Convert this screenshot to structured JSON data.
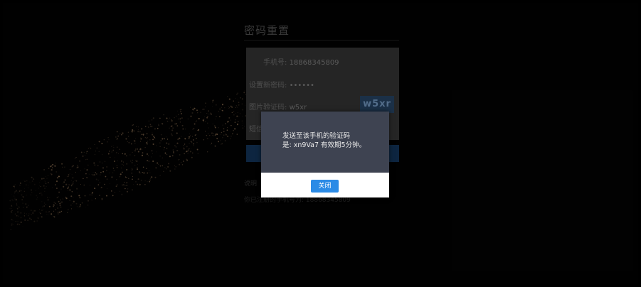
{
  "page": {
    "title": "密码重置",
    "colors": {
      "background": "#000000",
      "modal_body": "#3e4351",
      "primary_button": "#2b8be6"
    }
  },
  "form": {
    "phone_label": "手机号:",
    "phone_value": "18868345809",
    "new_password_label": "设置新密码:",
    "new_password_value": "••••••",
    "image_captcha_label": "图片验证码:",
    "image_captcha_value": "w5xr",
    "captcha_image_text": "w5xr",
    "sms_code_label": "短信"
  },
  "footer": {
    "tip": "说明",
    "registered_phone": "你已注册的手机号为: 18868345809"
  },
  "modal": {
    "message_line1": "发送至该手机的验证码",
    "message_line2": "是: xn9Va7 有效期5分钟。",
    "close_label": "关闭"
  }
}
